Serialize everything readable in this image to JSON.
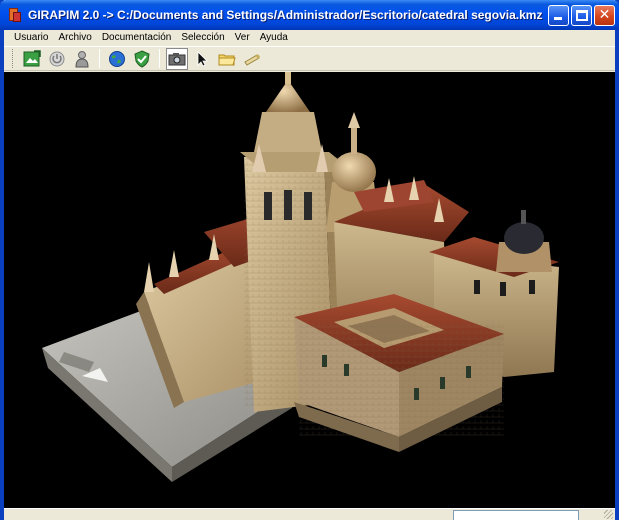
{
  "window": {
    "title": "GIRAPIM 2.0 -> C:/Documents and Settings/Administrador/Escritorio/catedral segovia.kmz",
    "controls": [
      "minimize-icon",
      "maximize-icon",
      "close-icon"
    ]
  },
  "menu": {
    "items": [
      "Usuario",
      "Archivo",
      "Documentación",
      "Selección",
      "Ver",
      "Ayuda"
    ]
  },
  "toolbar": {
    "tools": [
      {
        "name": "export-image-icon",
        "active": false
      },
      {
        "name": "power-icon",
        "active": false
      },
      {
        "name": "user-icon",
        "active": false
      },
      {
        "name": "globe-icon",
        "active": false
      },
      {
        "name": "shield-check-icon",
        "active": false
      },
      {
        "name": "camera-icon",
        "active": true
      },
      {
        "name": "pointer-icon",
        "active": false
      },
      {
        "name": "folder-icon",
        "active": false
      },
      {
        "name": "tube-icon",
        "active": false
      }
    ]
  },
  "viewport": {
    "content": "3d-model-view",
    "background": "#000000"
  },
  "status": {
    "field_value": ""
  },
  "colors": {
    "titlebar": "#0050ee",
    "chrome": "#ece9d8",
    "stone": "#c8b28a",
    "roof": "#8a3b26",
    "plaza": "#a7a59e"
  }
}
